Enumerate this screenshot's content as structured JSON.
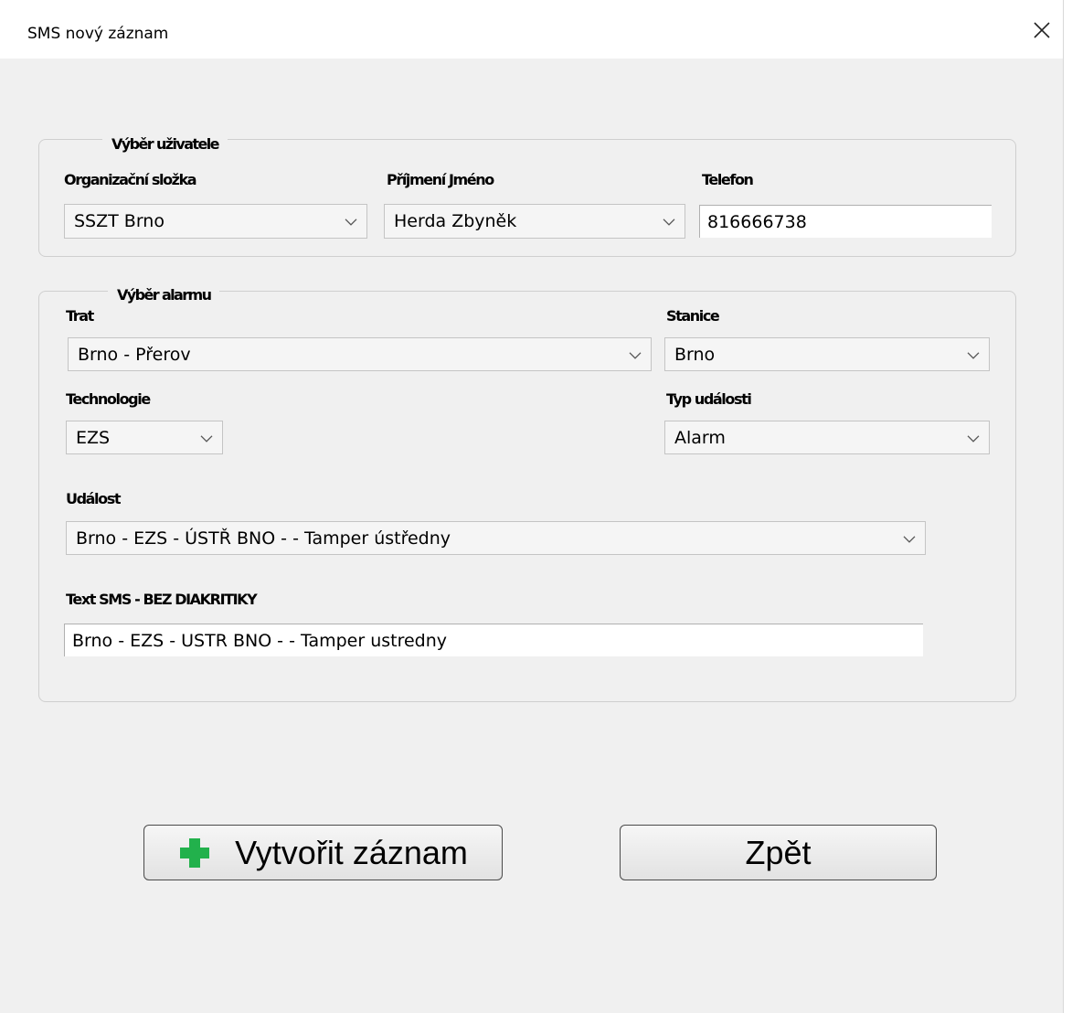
{
  "window": {
    "title": "SMS nový záznam"
  },
  "user_group": {
    "legend": "Výběr uživatele",
    "org_label": "Organizační složka",
    "org_value": "SSZT Brno",
    "name_label": "Příjmení Jméno",
    "name_value": "Herda Zbyněk",
    "phone_label": "Telefon",
    "phone_value": "816666738"
  },
  "alarm_group": {
    "legend": "Výběr alarmu",
    "trat_label": "Trat",
    "trat_value": "Brno - Přerov",
    "stanice_label": "Stanice",
    "stanice_value": "Brno",
    "tech_label": "Technologie",
    "tech_value": "EZS",
    "typ_label": "Typ události",
    "typ_value": "Alarm",
    "udalost_label": "Událost",
    "udalost_value": "Brno - EZS - ÚSTŘ BNO - - Tamper ústředny",
    "sms_label": "Text SMS - BEZ DIAKRITIKY",
    "sms_value": "Brno - EZS - USTR BNO - - Tamper ustredny"
  },
  "buttons": {
    "create_label": "Vytvořit záznam",
    "back_label": "Zpět"
  },
  "icons": {
    "close": "close-icon",
    "add": "plus-icon",
    "dropdown": "chevron-down-icon"
  },
  "colors": {
    "plus": "#22b14c",
    "background": "#f0f0f0"
  }
}
